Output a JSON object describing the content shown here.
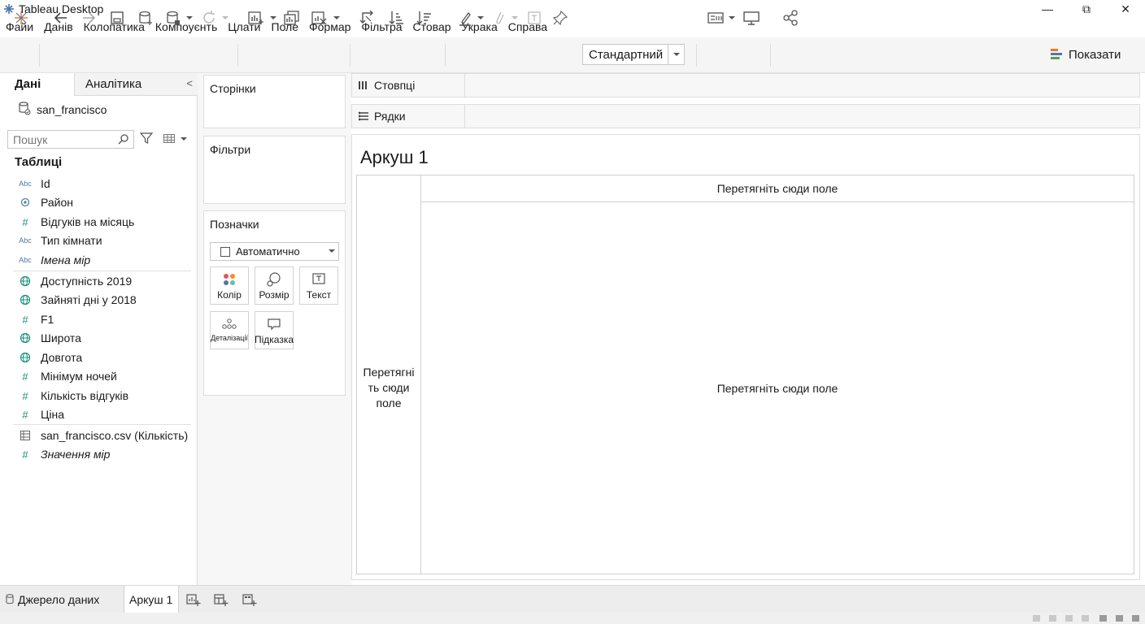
{
  "window": {
    "title": "Tableau Desktop",
    "controls": [
      "minimize-icon",
      "restore-icon",
      "close-icon"
    ],
    "control_glyphs": [
      "—",
      "⧉",
      "✕"
    ]
  },
  "menu": [
    "Файи",
    "Данів",
    "Колопатика",
    "Компоуєнть",
    "Цлати",
    "Поле",
    "Формар",
    "Фільтра",
    "Стовар",
    "Укрaка",
    "Справа"
  ],
  "toolbar": {
    "icons": [
      "tableau-logo-icon",
      "undo-icon",
      "redo-icon",
      "save-icon",
      "new-datasource-icon",
      "pause-updates-icon",
      "refresh-icon",
      "new-worksheet-icon",
      "duplicate-sheet-icon",
      "clear-sheet-icon",
      "swap-icon",
      "sort-ascending-icon",
      "sort-descending-icon",
      "highlight-icon",
      "group-icon",
      "labels-icon",
      "pin-icon",
      "fit-icon",
      "presentation-icon",
      "share-icon"
    ],
    "fit_select": "Стандартний",
    "show_me_label": "Показати"
  },
  "data_pane": {
    "tab_data": "Дані",
    "tab_analytics": "Аналітика",
    "collapse_glyph": "<",
    "datasource": "san_francisco",
    "search_placeholder": "Пошук",
    "tables_heading": "Таблиці",
    "fields": [
      {
        "type": "Abc",
        "name": "Id"
      },
      {
        "type": "geo",
        "name": "Район"
      },
      {
        "type": "#",
        "name": "Відгуків на місяць"
      },
      {
        "type": "Abc",
        "name": "Тип кімнати"
      },
      {
        "type": "Abc",
        "name": "Імена мір",
        "italic": true
      },
      {
        "type": "globe",
        "name": "Доступність 2019"
      },
      {
        "type": "globe",
        "name": "Зайняті дні у 2018"
      },
      {
        "type": "#",
        "name": "F1"
      },
      {
        "type": "globe",
        "name": "Широта"
      },
      {
        "type": "globe",
        "name": "Довгота"
      },
      {
        "type": "#",
        "name": "Мінімум ночей"
      },
      {
        "type": "#",
        "name": "Кількість відгуків"
      },
      {
        "type": "#",
        "name": "Ціна"
      },
      {
        "type": "table",
        "name": "san_francisco.csv (Кількість)"
      },
      {
        "type": "#",
        "name": "Значення мір",
        "italic": true
      }
    ]
  },
  "cards": {
    "pages": "Сторінки",
    "filters": "Фільтри",
    "marks": "Позначки",
    "mark_type": "Автоматично",
    "mark_buttons": [
      "Колір",
      "Розмір",
      "Текст",
      "Деталізації",
      "Підказка"
    ]
  },
  "shelves": {
    "columns": "Стовпці",
    "rows": "Рядки"
  },
  "sheet": {
    "title": "Аркуш 1",
    "drop_top": "Перетягніть сюди поле",
    "drop_left": "Перетягні ть сюди поле",
    "drop_center": "Перетягніть сюди поле"
  },
  "bottom_tabs": {
    "datasource_tab": "Джерело даних",
    "sheet_tab": "Аркуш 1",
    "new_tab_icons": [
      "new-worksheet-tab-icon",
      "new-dashboard-tab-icon",
      "new-story-tab-icon"
    ]
  },
  "colors": {
    "dimension_icon": "#4a7a9b",
    "measure_icon": "#1c8f78",
    "show_me_bars": [
      "#e8762b",
      "#4e79a7",
      "#59a14f"
    ]
  }
}
